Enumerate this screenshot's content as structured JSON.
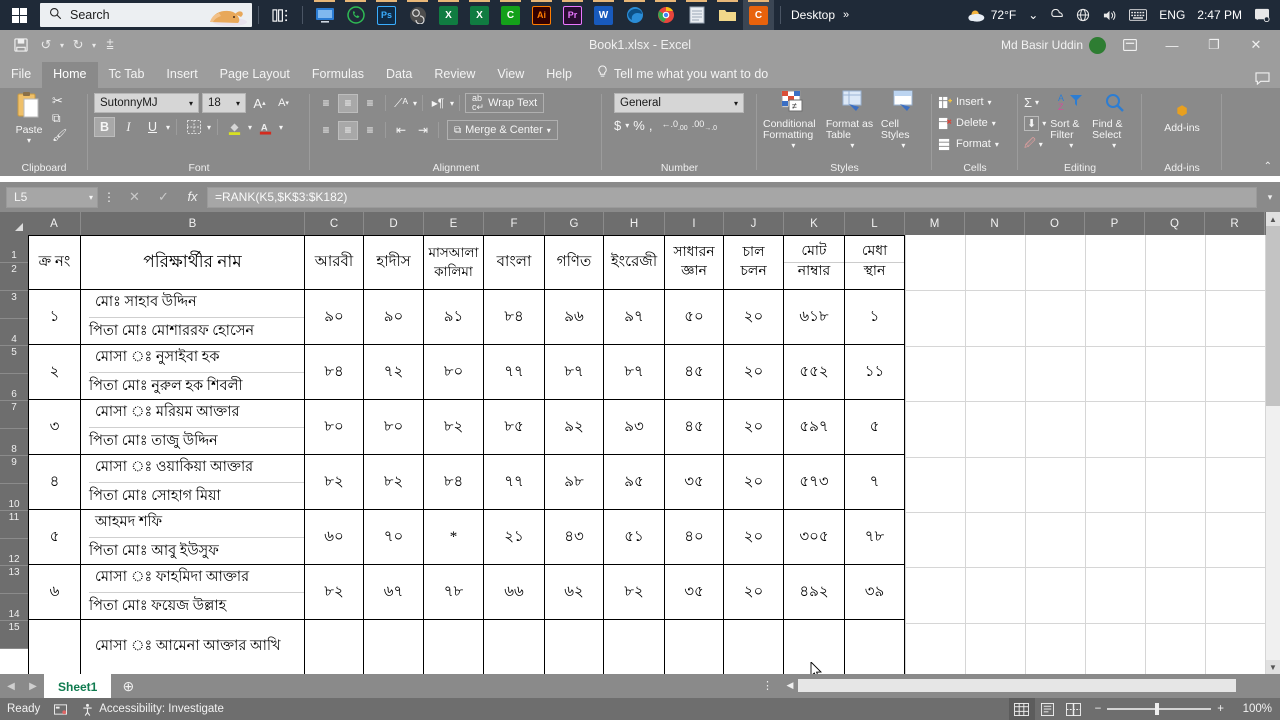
{
  "taskbar": {
    "search_placeholder": "Search",
    "apps": [
      {
        "name": "task-view",
        "glyph": "❏"
      },
      {
        "name": "teams",
        "glyph": "🖥"
      },
      {
        "name": "whatsapp",
        "glyph": "✆"
      },
      {
        "name": "photoshop",
        "glyph": "Ps"
      },
      {
        "name": "obs-studio",
        "glyph": "◎"
      },
      {
        "name": "excel",
        "glyph": "X"
      },
      {
        "name": "excel",
        "glyph": "X"
      },
      {
        "name": "camtasia",
        "glyph": "C"
      },
      {
        "name": "illustrator",
        "glyph": "Ai"
      },
      {
        "name": "premiere-pro",
        "glyph": "Pr"
      },
      {
        "name": "word",
        "glyph": "W"
      },
      {
        "name": "edge",
        "glyph": "e"
      },
      {
        "name": "chrome",
        "glyph": "◉"
      },
      {
        "name": "notepad",
        "glyph": "▤"
      },
      {
        "name": "folder",
        "glyph": "▬"
      },
      {
        "name": "camtasia-active",
        "glyph": "C"
      }
    ],
    "desktop_label": "Desktop",
    "overflow_chevron": "»",
    "temperature": "72°F",
    "language": "ENG",
    "clock": "2:47 PM"
  },
  "titlebar": {
    "document_title": "Book1.xlsx - Excel",
    "account_name": "Md Basir Uddin",
    "quick_access": [
      "save-icon",
      "undo-icon",
      "redo-icon",
      "customize-icon"
    ],
    "window_buttons": [
      "ribbon-display-options",
      "minimize",
      "restore",
      "close"
    ]
  },
  "ribbon": {
    "tabs": [
      "File",
      "Home",
      "Tc Tab",
      "Insert",
      "Page Layout",
      "Formulas",
      "Data",
      "Review",
      "View",
      "Help"
    ],
    "active_tab": "Home",
    "tell_me": "Tell me what you want to do",
    "groups": {
      "clipboard": {
        "label": "Clipboard",
        "paste": "Paste"
      },
      "font": {
        "label": "Font",
        "font_name": "SutonnyMJ",
        "font_size": "18",
        "bold": "B",
        "italic": "I",
        "underline": "U",
        "grow": "A",
        "shrink": "A"
      },
      "alignment": {
        "label": "Alignment",
        "wrap_text": "Wrap Text",
        "merge_center": "Merge & Center"
      },
      "number": {
        "label": "Number",
        "format": "General",
        "currency": "$",
        "percent": "%",
        "comma": ","
      },
      "styles": {
        "label": "Styles",
        "conditional_formatting": "Conditional Formatting",
        "format_as_table": "Format as Table",
        "cell_styles": "Cell Styles"
      },
      "cells": {
        "label": "Cells",
        "insert": "Insert",
        "delete": "Delete",
        "format": "Format"
      },
      "editing": {
        "label": "Editing",
        "sort_filter": "Sort & Filter",
        "find_select": "Find & Select"
      },
      "addins": {
        "label": "Add-ins",
        "button": "Add-ins"
      }
    }
  },
  "formula_bar": {
    "name_box": "L5",
    "formula": "=RANK(K5,$K$3:$K182)",
    "cancel_icon": "✕",
    "enter_icon": "✓",
    "fx_icon": "fx"
  },
  "grid": {
    "columns": [
      "A",
      "B",
      "C",
      "D",
      "E",
      "F",
      "G",
      "H",
      "I",
      "J",
      "K",
      "L",
      "M",
      "N",
      "O",
      "P",
      "Q",
      "R"
    ],
    "rows": [
      "1",
      "2",
      "3",
      "4",
      "5",
      "6",
      "7",
      "8",
      "9",
      "10",
      "11",
      "12",
      "13",
      "14",
      "15"
    ],
    "headers": {
      "serial": "ক্র নং",
      "name": "পরিক্ষার্থীর নাম",
      "arabic": "আরবী",
      "hadith": "হাদীস",
      "masala_1": "মাসআলা",
      "masala_2": "কালিমা",
      "bangla": "বাংলা",
      "math": "গণিত",
      "english": "ইংরেজী",
      "general_1": "সাধারন",
      "general_2": "জ্ঞান",
      "conduct_1": "চাল",
      "conduct_2": "চলন",
      "total_1": "মোট",
      "total_2": "নাম্বার",
      "merit_1": "মেধা",
      "merit_2": "স্থান"
    },
    "students": [
      {
        "serial": "১",
        "name": "মোঃ সাহাব উদ্দিন",
        "father": "পিতা মোঃ মোশাররফ হোসেন",
        "arabic": "৯০",
        "hadith": "৯০",
        "masala": "৯১",
        "bangla": "৮৪",
        "math": "৯৬",
        "english": "৯৭",
        "general": "৫০",
        "conduct": "২০",
        "total": "৬১৮",
        "merit": "১"
      },
      {
        "serial": "২",
        "name": "মোসা ঃ নুসাইবা হক",
        "father": "পিতা মোঃ নুরুল হক শিবলী",
        "arabic": "৮৪",
        "hadith": "৭২",
        "masala": "৮০",
        "bangla": "৭৭",
        "math": "৮৭",
        "english": "৮৭",
        "general": "৪৫",
        "conduct": "২০",
        "total": "৫৫২",
        "merit": "১১"
      },
      {
        "serial": "৩",
        "name": "মোসা ঃ মরিয়ম আক্তার",
        "father": "পিতা মোঃ তাজু উদ্দিন",
        "arabic": "৮০",
        "hadith": "৮০",
        "masala": "৮২",
        "bangla": "৮৫",
        "math": "৯২",
        "english": "৯৩",
        "general": "৪৫",
        "conduct": "২০",
        "total": "৫৯৭",
        "merit": "৫"
      },
      {
        "serial": "৪",
        "name": "মোসা ঃ ওয়াকিয়া আক্তার",
        "father": "পিতা মোঃ সোহাগ মিয়া",
        "arabic": "৮২",
        "hadith": "৮২",
        "masala": "৮৪",
        "bangla": "৭৭",
        "math": "৯৮",
        "english": "৯৫",
        "general": "৩৫",
        "conduct": "২০",
        "total": "৫৭৩",
        "merit": "৭"
      },
      {
        "serial": "৫",
        "name": "আহমদ শফি",
        "father": "পিতা মোঃ আবু ইউসুফ",
        "arabic": "৬০",
        "hadith": "৭০",
        "masala": "*",
        "bangla": "২১",
        "math": "৪৩",
        "english": "৫১",
        "general": "৪০",
        "conduct": "২০",
        "total": "৩০৫",
        "merit": "৭৮"
      },
      {
        "serial": "৬",
        "name": "মোসা ঃ ফাহমিদা আক্তার",
        "father": "পিতা মোঃ ফয়েজ উল্লাহ",
        "arabic": "৮২",
        "hadith": "৬৭",
        "masala": "৭৮",
        "bangla": "৬৬",
        "math": "৬২",
        "english": "৮২",
        "general": "৩৫",
        "conduct": "২০",
        "total": "৪৯২",
        "merit": "৩৯"
      },
      {
        "serial": "",
        "name": "মোসা ঃ আমেনা আক্তার আখি",
        "father": "",
        "arabic": "",
        "hadith": "",
        "masala": "",
        "bangla": "",
        "math": "",
        "english": "",
        "general": "",
        "conduct": "",
        "total": "",
        "merit": ""
      }
    ]
  },
  "sheetbar": {
    "prev_icon": "◀",
    "next_icon": "▶",
    "sheet_name": "Sheet1",
    "add_sheet_icon": "⊕"
  },
  "status_bar": {
    "mode": "Ready",
    "accessibility": "Accessibility: Investigate",
    "views": [
      "normal-view",
      "page-layout-view",
      "page-break-view"
    ],
    "zoom_out": "−",
    "zoom_in": "+",
    "zoom_level": "100%"
  },
  "colors": {
    "taskbar_bg": "#1f2a38",
    "ribbon_bg": "#8a8a8a",
    "titlebar_bg": "#9d9d9d",
    "header_bg": "#6e6e6e",
    "sheet_tab_accent": "#0f7b4f",
    "excel_green": "#107c41"
  }
}
